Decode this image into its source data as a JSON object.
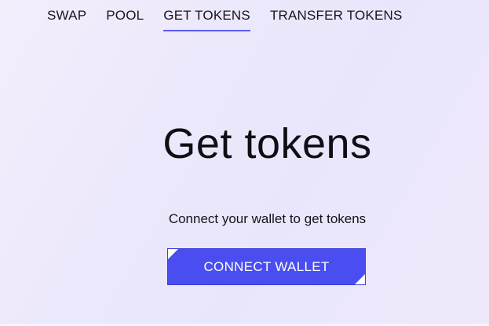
{
  "nav": {
    "tabs": [
      {
        "label": "SWAP",
        "active": false
      },
      {
        "label": "POOL",
        "active": false
      },
      {
        "label": "GET TOKENS",
        "active": true
      },
      {
        "label": "TRANSFER TOKENS",
        "active": false
      }
    ]
  },
  "main": {
    "title": "Get tokens",
    "subtitle": "Connect your wallet to get tokens",
    "connect_button_label": "CONNECT WALLET"
  },
  "colors": {
    "accent": "#4a4ef0",
    "active_underline": "#5a5cf0",
    "background": "#ece8fb"
  }
}
